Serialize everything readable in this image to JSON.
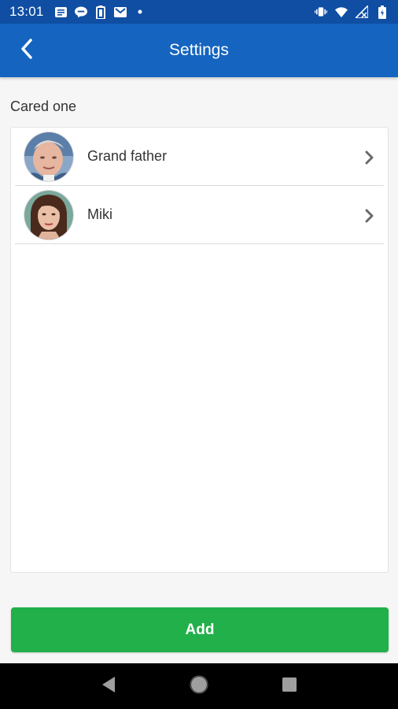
{
  "status_bar": {
    "time": "13:01",
    "left_icons": [
      "sms-icon",
      "line-chat-icon",
      "battery-saver-icon",
      "gmail-icon",
      "dot-icon"
    ],
    "right_icons": [
      "vibrate-icon",
      "wifi-icon",
      "no-signal-icon",
      "battery-icon"
    ]
  },
  "app_bar": {
    "title": "Settings",
    "back_icon": "chevron-left-icon",
    "color": "#1564c0"
  },
  "section": {
    "label": "Cared one"
  },
  "cared_ones": [
    {
      "name": "Grand father",
      "avatar": "elderly-man-photo"
    },
    {
      "name": "Miki",
      "avatar": "young-woman-photo"
    }
  ],
  "add_button": {
    "label": "Add",
    "color": "#21b04a"
  },
  "nav_bar": {
    "buttons": [
      "back-triangle-icon",
      "home-circle-icon",
      "recents-square-icon"
    ]
  }
}
